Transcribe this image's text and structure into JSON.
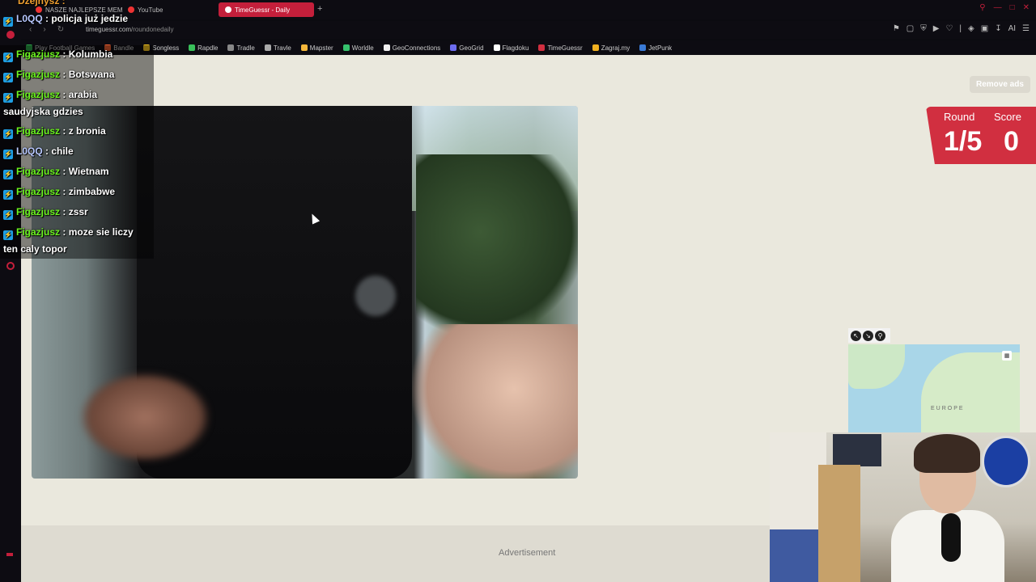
{
  "browser": {
    "tabs": [
      {
        "label": "NASZE NAJLEPSZE MEM"
      },
      {
        "label": "YouTube"
      },
      {
        "label": "TimeGuessr - Daily"
      }
    ],
    "new_tab_symbol": "+",
    "url_host": "timeguessr.com",
    "url_path": "/roundonedaily",
    "bookmarks": [
      {
        "label": "Play Football Games",
        "color": "#2a9d46"
      },
      {
        "label": "Bandle",
        "color": "#e85d30"
      },
      {
        "label": "Songless",
        "color": "#f0c020"
      },
      {
        "label": "Rapdle",
        "color": "#39c05a"
      },
      {
        "label": "Tradle",
        "color": "#888888"
      },
      {
        "label": "Travle",
        "color": "#aaaaaa"
      },
      {
        "label": "Mapster",
        "color": "#f5b73b"
      },
      {
        "label": "Worldle",
        "color": "#36c26d"
      },
      {
        "label": "GeoConnections",
        "color": "#f0f0f0"
      },
      {
        "label": "GeoGrid",
        "color": "#6d6df0"
      },
      {
        "label": "Flagdoku",
        "color": "#ffffff"
      },
      {
        "label": "TimeGuessr",
        "color": "#d12f40"
      },
      {
        "label": "Zagraj.my",
        "color": "#f0b020"
      },
      {
        "label": "JetPunk",
        "color": "#3a7ad6"
      }
    ],
    "toolbar_ai_label": "AI"
  },
  "page": {
    "remove_ads_label": "Remove ads",
    "round_label": "Round",
    "round_value": "1/5",
    "score_label": "Score",
    "score_value": "0",
    "map_label": "EUROPE",
    "advertisement_label": "Advertisement",
    "accent_color": "#d12f40"
  },
  "chat": {
    "top_partial": "Dzejnysz :",
    "messages": [
      {
        "user": "L0QQ",
        "text": ": policja już jedzie",
        "color": "blue"
      },
      {
        "user": "Figazjusz",
        "text": ": Kolumbia",
        "color": "green"
      },
      {
        "user": "Figazjusz",
        "text": ": Botswana",
        "color": "green"
      },
      {
        "user": "Figazjusz",
        "text": ": arabia",
        "color": "green"
      },
      {
        "user": "",
        "text": "saudyjska gdzies",
        "color": ""
      },
      {
        "user": "Figazjusz",
        "text": ": z bronia",
        "color": "green"
      },
      {
        "user": "L0QQ",
        "text": ": chile",
        "color": "blue"
      },
      {
        "user": "Figazjusz",
        "text": ": Wietnam",
        "color": "green"
      },
      {
        "user": "Figazjusz",
        "text": ": zimbabwe",
        "color": "green"
      },
      {
        "user": "Figazjusz",
        "text": ": zssr",
        "color": "green"
      },
      {
        "user": "Figazjusz",
        "text": ": moze sie liczy",
        "color": "green"
      },
      {
        "user": "",
        "text": "ten caly topor",
        "color": ""
      }
    ]
  }
}
